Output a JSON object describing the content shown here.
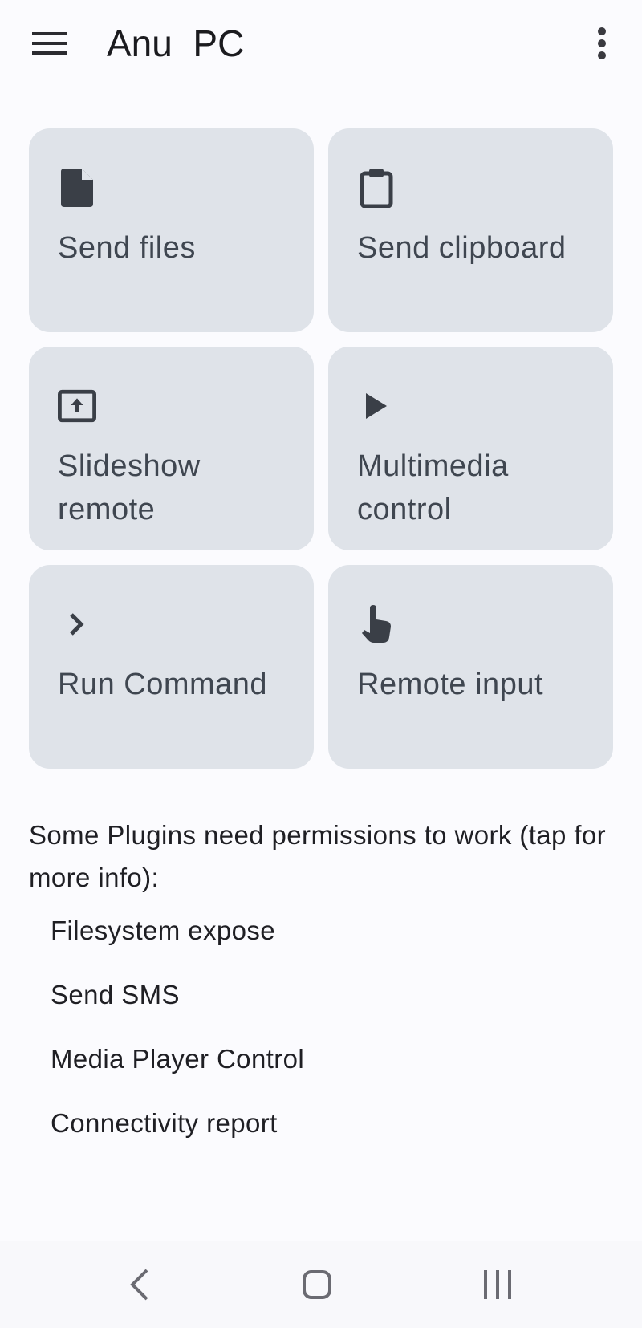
{
  "appbar": {
    "title": "Anu  PC",
    "menu_icon": "hamburger-menu-icon",
    "overflow_icon": "more-vert-icon"
  },
  "tiles": [
    {
      "label": "Send files",
      "icon": "file-icon"
    },
    {
      "label": "Send clipboard",
      "icon": "clipboard-icon"
    },
    {
      "label": "Slideshow remote",
      "icon": "presentation-icon"
    },
    {
      "label": "Multimedia control",
      "icon": "play-icon"
    },
    {
      "label": "Run Command",
      "icon": "chevron-right-icon"
    },
    {
      "label": "Remote input",
      "icon": "touch-icon"
    }
  ],
  "permissions": {
    "note": "Some Plugins need permissions to work (tap for more info):",
    "items": [
      "Filesystem expose",
      "Send SMS",
      "Media Player Control",
      "Connectivity report"
    ]
  },
  "navbar": {
    "back_icon": "back-icon",
    "home_icon": "home-icon",
    "recents_icon": "recents-icon"
  },
  "colors": {
    "background": "#fbfbfe",
    "tile": "#dfe3e9",
    "tile_text": "#3f4650",
    "icon": "#3a3f47"
  }
}
